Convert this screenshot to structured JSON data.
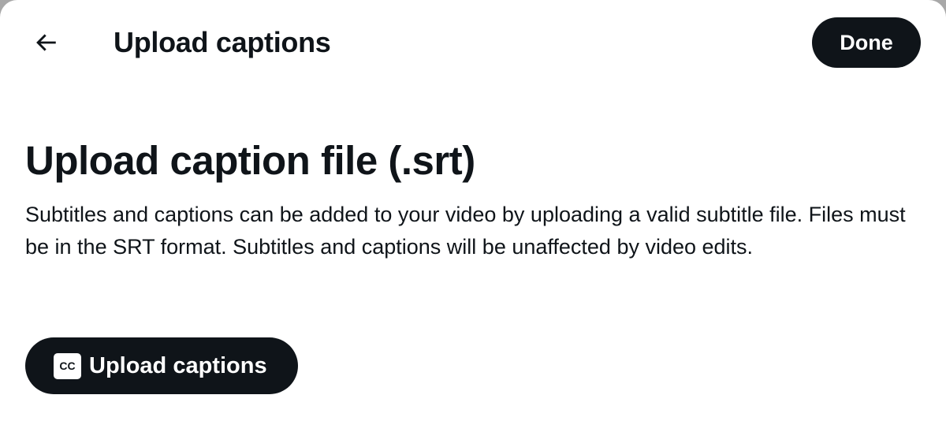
{
  "header": {
    "title": "Upload captions",
    "done_label": "Done",
    "back_icon": "arrow-left-icon"
  },
  "content": {
    "section_title": "Upload caption file (.srt)",
    "description": "Subtitles and captions can be added to your video by uploading a valid subtitle file. Files must be in the SRT format. Subtitles and captions will be unaffected by video edits."
  },
  "upload_button": {
    "icon_text": "CC",
    "icon": "closed-captions-icon",
    "label": "Upload captions"
  },
  "colors": {
    "primary": "#0f1419",
    "background": "#ffffff",
    "button_text": "#ffffff"
  }
}
